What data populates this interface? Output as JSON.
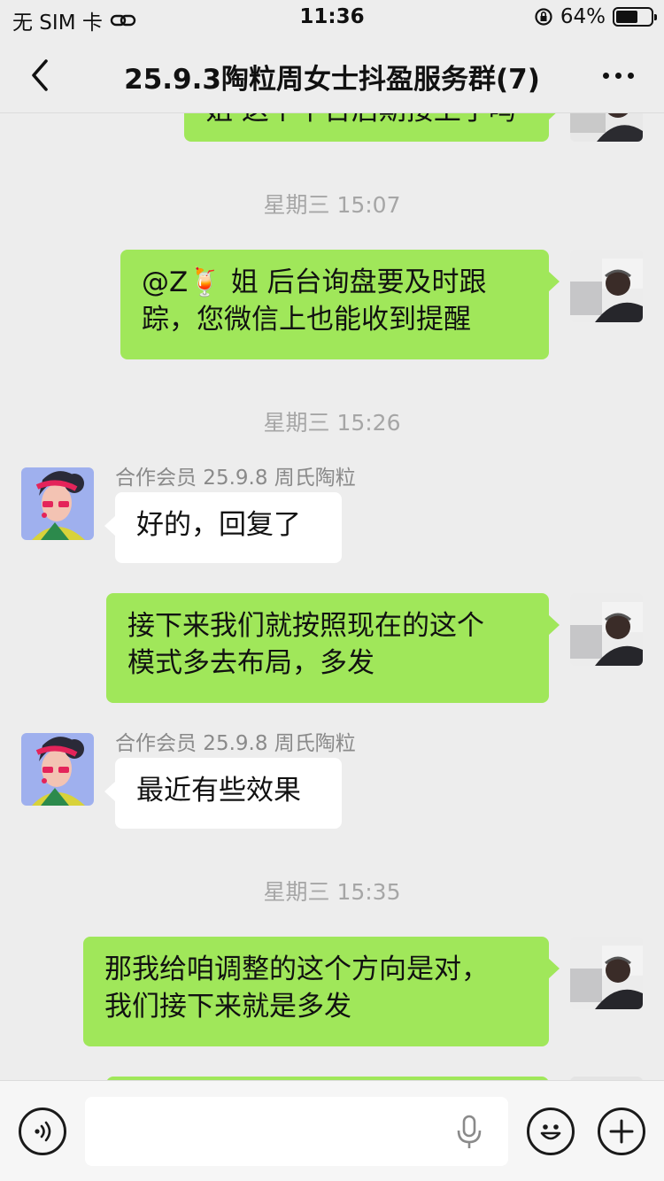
{
  "status_bar": {
    "carrier": "无 SIM 卡",
    "time": "11:36",
    "battery": "64%",
    "battery_level": 0.64
  },
  "nav": {
    "title": "25.9.3陶粒周女士抖盈服务群(7)"
  },
  "messages": [
    {
      "side": "me",
      "lines": [
        "姐 这个平台后期接上了吗"
      ],
      "partial": true
    },
    {
      "type": "timestamp",
      "text": "星期三 15:07"
    },
    {
      "side": "me",
      "lines": [
        "@Z🍹 姐 后台询盘要及时跟",
        "踪，您微信上也能收到提醒"
      ]
    },
    {
      "type": "timestamp",
      "text": "星期三 15:26"
    },
    {
      "side": "them",
      "sender": "合作会员 25.9.8 周氏陶粒",
      "lines": [
        "好的，回复了"
      ]
    },
    {
      "side": "me",
      "lines": [
        "接下来我们就按照现在的这个",
        "模式多去布局，多发"
      ]
    },
    {
      "side": "them",
      "sender": "合作会员 25.9.8 周氏陶粒",
      "lines": [
        "最近有些效果"
      ]
    },
    {
      "type": "timestamp",
      "text": "星期三 15:35"
    },
    {
      "side": "me",
      "lines": [
        "那我给咱调整的这个方向是对，",
        "我们接下来就是多发"
      ]
    }
  ],
  "input": {
    "placeholder": ""
  },
  "colors": {
    "my_bubble": "#a0e75a",
    "their_bubble": "#ffffff",
    "background": "#ededed"
  },
  "icons": [
    "back-arrow-icon",
    "more-icon",
    "voice-icon",
    "microphone-icon",
    "emoji-icon",
    "plus-icon"
  ]
}
